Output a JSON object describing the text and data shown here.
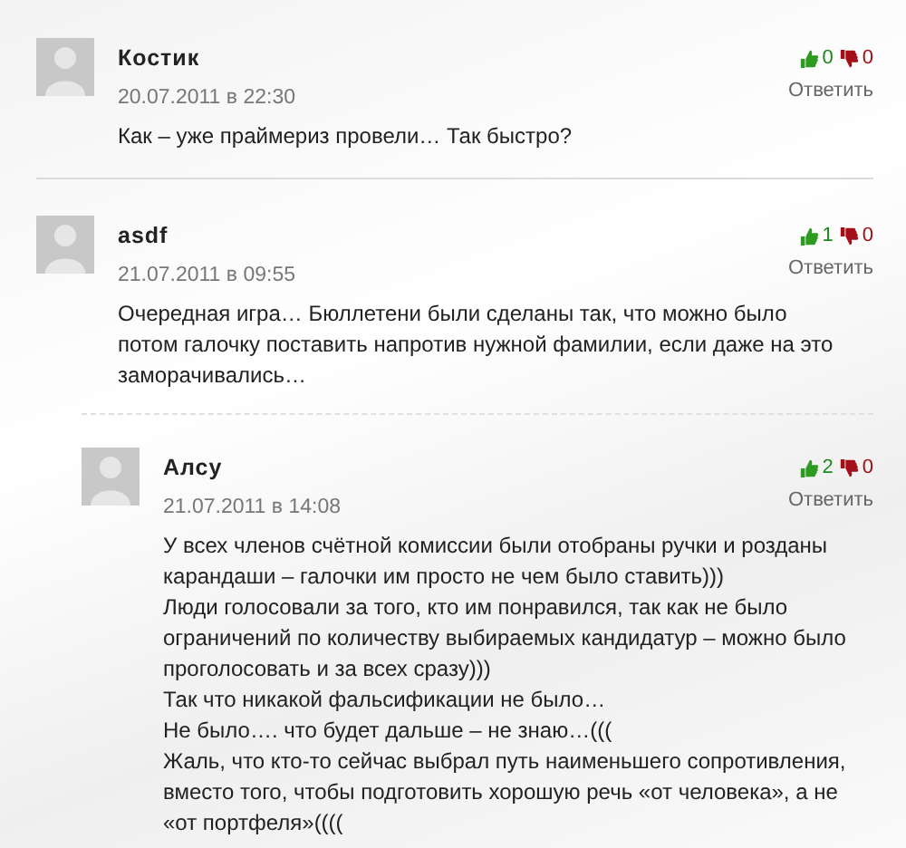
{
  "comments": [
    {
      "author": "Костик",
      "date": "20.07.2011 в 22:30",
      "likes": "0",
      "dislikes": "0",
      "reply": "Ответить",
      "text": "Как – уже праймериз провели… Так быстро?"
    },
    {
      "author": "asdf",
      "date": "21.07.2011 в 09:55",
      "likes": "1",
      "dislikes": "0",
      "reply": "Ответить",
      "text": "Очередная игра… Бюллетени были сделаны так, что можно было потом галочку поставить напротив нужной фамилии, если даже на это заморачивались…",
      "children": [
        {
          "author": "Алсу",
          "date": "21.07.2011 в 14:08",
          "likes": "2",
          "dislikes": "0",
          "reply": "Ответить",
          "text": "У всех членов счётной комиссии были отобраны ручки и розданы карандаши – галочки им просто не чем было ставить)))\nЛюди голосовали за того, кто им понравился, так как не было ограничений по количеству выбираемых кандидатур – можно было проголосовать и за всех сразу)))\nТак что никакой фальсификации не было…\nНе было…. что будет дальше – не знаю…(((\nЖаль, что кто-то сейчас выбрал путь наименьшего сопротивления, вместо того, чтобы подготовить хорошую речь «от человека», а не «от портфеля»(((("
        }
      ]
    }
  ]
}
